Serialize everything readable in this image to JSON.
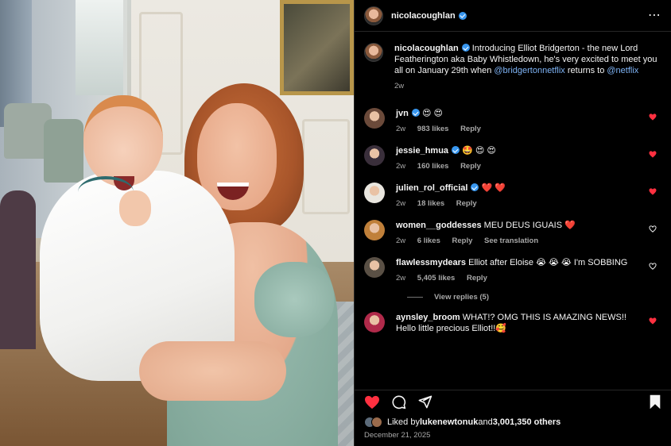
{
  "post": {
    "username": "nicolacoughlan",
    "caption_username": "nicolacoughlan",
    "caption_text_1": " Introducing Elliot Bridgerton - the new Lord Featherington aka Baby Whistledown, he's very excited to meet you all on January 29th when ",
    "caption_mention_1": "@bridgertonnetflix",
    "caption_text_2": " returns to ",
    "caption_mention_2": "@netflix",
    "caption_time": "2w",
    "more_icon": "⋯"
  },
  "comments": [
    {
      "user": "jvn",
      "verified": true,
      "text": "😍 😍",
      "time": "2w",
      "likes": "983 likes",
      "reply": "Reply",
      "liked": true,
      "avatar_color": "#6b4a3a"
    },
    {
      "user": "jessie_hmua",
      "verified": true,
      "text": "🤩 😍 😍",
      "time": "2w",
      "likes": "160 likes",
      "reply": "Reply",
      "liked": true,
      "avatar_color": "#3a2f3b"
    },
    {
      "user": "julien_rol_official",
      "verified": true,
      "text": "❤️ ❤️",
      "time": "2w",
      "likes": "18 likes",
      "reply": "Reply",
      "liked": true,
      "avatar_color": "#e9e6df"
    },
    {
      "user": "women__goddesses",
      "verified": false,
      "text": "MEU DEUS IGUAIS ❤️",
      "time": "2w",
      "likes": "6 likes",
      "reply": "Reply",
      "extra": "See translation",
      "liked": false,
      "avatar_color": "#c0803a"
    },
    {
      "user": "flawlessmydears",
      "verified": false,
      "text": "Elliot after Eloise 😭 😭 😭  I'm SOBBING",
      "time": "2w",
      "likes": "5,405 likes",
      "reply": "Reply",
      "liked": false,
      "avatar_color": "#5a5045"
    },
    {
      "user": "aynsley_broom",
      "verified": false,
      "text": "WHAT!? OMG THIS IS AMAZING NEWS!! Hello little precious Elliot!!🥰",
      "time": "",
      "likes": "",
      "reply": "",
      "liked": true,
      "avatar_color": "#b02a4a"
    }
  ],
  "view_replies": "View replies (5)",
  "actions": {
    "like_icon": "heart-filled",
    "comment_icon": "comment",
    "share_icon": "send",
    "save_icon": "bookmark"
  },
  "likes": {
    "prefix": "Liked by ",
    "user": "lukenewtonuk",
    "middle": " and ",
    "count": "3,001,350 others"
  },
  "date": "December 21, 2025",
  "colors": {
    "accent_link": "#7eb3f5",
    "verified": "#3897f0",
    "heart": "#ff3040",
    "muted": "#a8a8a8",
    "background": "#000000"
  }
}
